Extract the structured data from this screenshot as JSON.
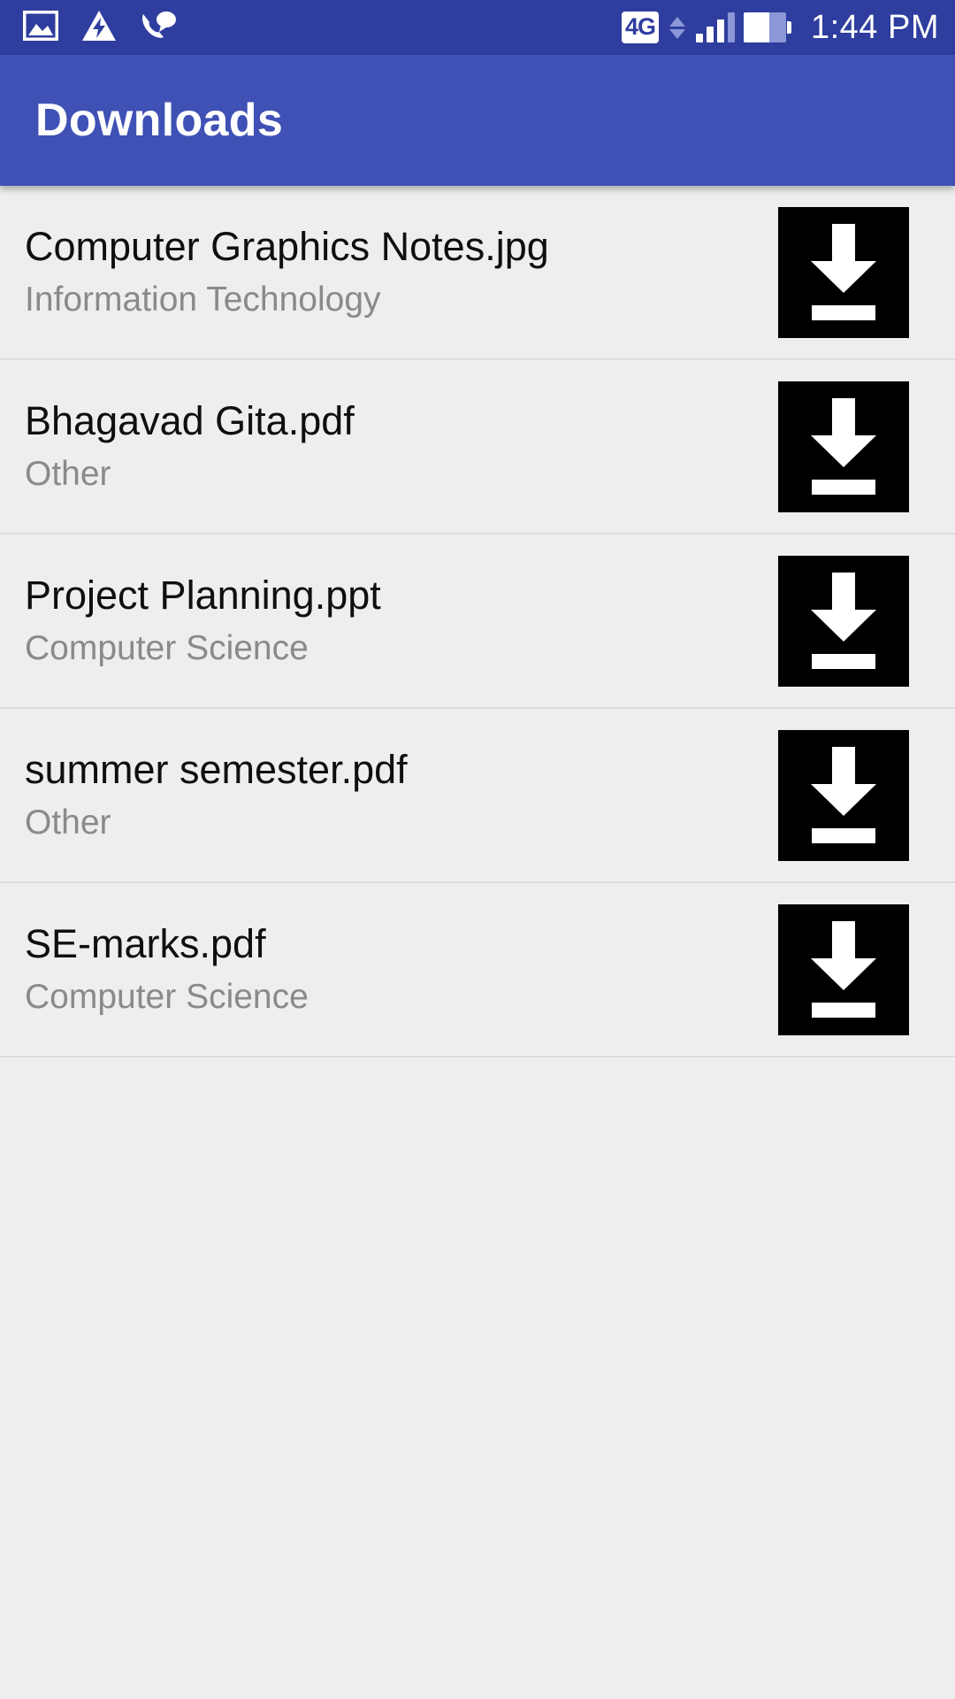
{
  "status_bar": {
    "background_color": "#2e3d9e",
    "left_icons": [
      {
        "name": "image-icon",
        "glyph": "image"
      },
      {
        "name": "warning-flash-icon",
        "glyph": "triangle-bolt"
      },
      {
        "name": "missed-call-icon",
        "glyph": "phone-bubble"
      }
    ],
    "network_type": "4G",
    "data_arrows": "up-down",
    "signal_bars_active": 3,
    "signal_bars_total": 4,
    "battery_level_percent": 60,
    "clock": "1:44 PM"
  },
  "app_bar": {
    "title": "Downloads",
    "background_color": "#3f51b5",
    "title_color": "#ffffff"
  },
  "list": {
    "background_color": "#eeeeee",
    "divider_color": "#dcdcdc",
    "title_color": "#0f0f0f",
    "subtitle_color": "#8a8a8a",
    "action_icon_name": "download-icon",
    "items": [
      {
        "title": "Computer Graphics Notes.jpg",
        "subtitle": "Information Technology"
      },
      {
        "title": "Bhagavad Gita.pdf",
        "subtitle": "Other"
      },
      {
        "title": "Project Planning.ppt",
        "subtitle": "Computer Science"
      },
      {
        "title": "summer semester.pdf",
        "subtitle": "Other"
      },
      {
        "title": "SE-marks.pdf",
        "subtitle": "Computer Science"
      }
    ]
  }
}
